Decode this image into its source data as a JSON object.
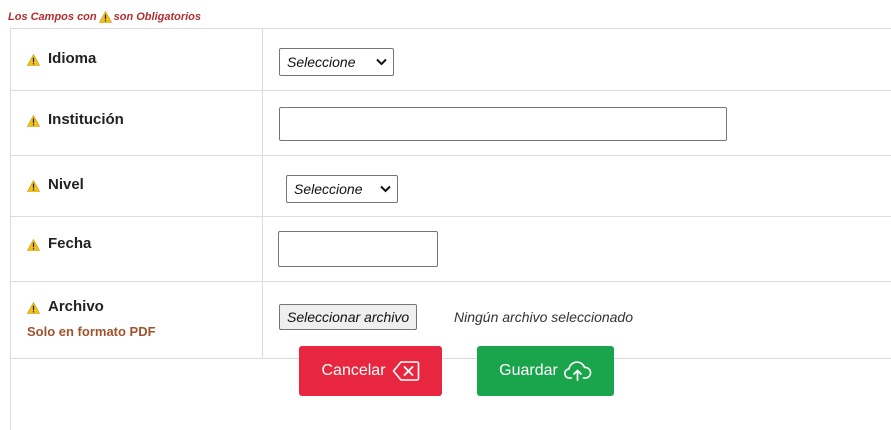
{
  "note": {
    "prefix": "Los Campos con",
    "suffix": "son Obligatorios"
  },
  "fields": {
    "idioma": {
      "label": "Idioma",
      "select_value": "Seleccione"
    },
    "institucion": {
      "label": "Institución",
      "value": ""
    },
    "nivel": {
      "label": "Nivel",
      "select_value": "Seleccione"
    },
    "fecha": {
      "label": "Fecha",
      "value": ""
    },
    "archivo": {
      "label": "Archivo",
      "hint": "Solo en formato PDF",
      "button_label": "Seleccionar archivo",
      "status": "Ningún archivo seleccionado"
    }
  },
  "actions": {
    "cancel_label": "Cancelar",
    "save_label": "Guardar"
  },
  "colors": {
    "required_note": "#b03030",
    "warning_icon": "#f2c018",
    "hint": "#a0522d",
    "cancel_button": "#e8263f",
    "save_button": "#1aa54d"
  },
  "icons": {
    "required": "warning-triangle-icon",
    "cancel": "backspace-x-icon",
    "save": "cloud-upload-icon"
  }
}
